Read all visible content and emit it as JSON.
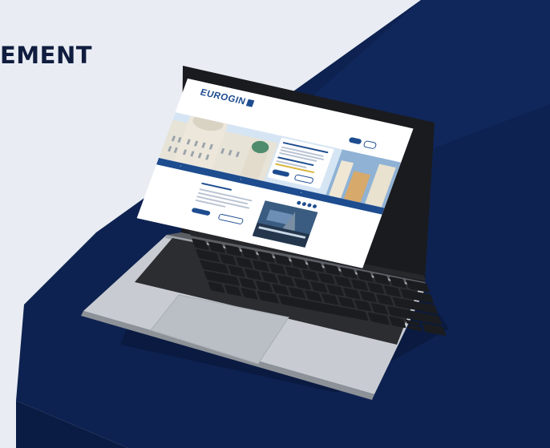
{
  "banner": {
    "headline": "EMENT"
  },
  "website": {
    "logo_text": "EUROGIN",
    "top_links": [
      "",
      ""
    ],
    "nav_items": [
      "",
      "",
      "",
      "",
      "",
      ""
    ],
    "primary_button": "",
    "secondary_button": "",
    "welcome_title": ""
  },
  "colors": {
    "background": "#e9edf3",
    "navy": "#0f2352",
    "headline": "#101d3f",
    "site_blue": "#1d4c8f",
    "laptop_silver": "#c8ccd2"
  },
  "icons": [
    "laptop-icon",
    "keyboard-icon",
    "trackpad-icon"
  ]
}
